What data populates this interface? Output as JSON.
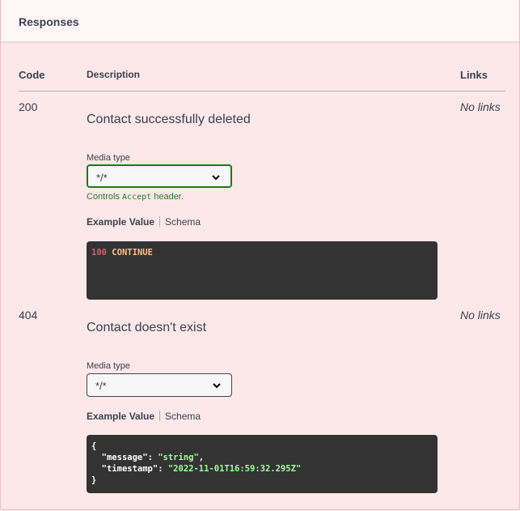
{
  "header": {
    "title": "Responses"
  },
  "columns": {
    "code": "Code",
    "description": "Description",
    "links": "Links"
  },
  "responses": [
    {
      "code": "200",
      "description": "Contact successfully deleted",
      "links": "No links",
      "media_label": "Media type",
      "media_value": "*/*",
      "controls_prefix": "Controls",
      "controls_code": "Accept",
      "controls_suffix": "header.",
      "tab_example": "Example Value",
      "tab_schema": "Schema",
      "example": {
        "status_code": "100",
        "status_text": "CONTINUE"
      }
    },
    {
      "code": "404",
      "description": "Contact doesn't exist",
      "links": "No links",
      "media_label": "Media type",
      "media_value": "*/*",
      "tab_example": "Example Value",
      "tab_schema": "Schema",
      "example": {
        "open": "{",
        "k1": "\"message\"",
        "v1": "\"string\"",
        "k2": "\"timestamp\"",
        "v2": "\"2022-11-01T16:59:32.295Z\"",
        "close": "}"
      }
    }
  ],
  "colors": {
    "background": "#fce8e8",
    "header_bg": "#fff6f6",
    "active_border": "#1a7b1a",
    "code_bg": "#333333",
    "code_number": "#d36363",
    "code_keyword": "#fcc28c",
    "code_string": "#a2fca2"
  },
  "icons": {
    "select_arrow": "chevron-down-icon"
  }
}
